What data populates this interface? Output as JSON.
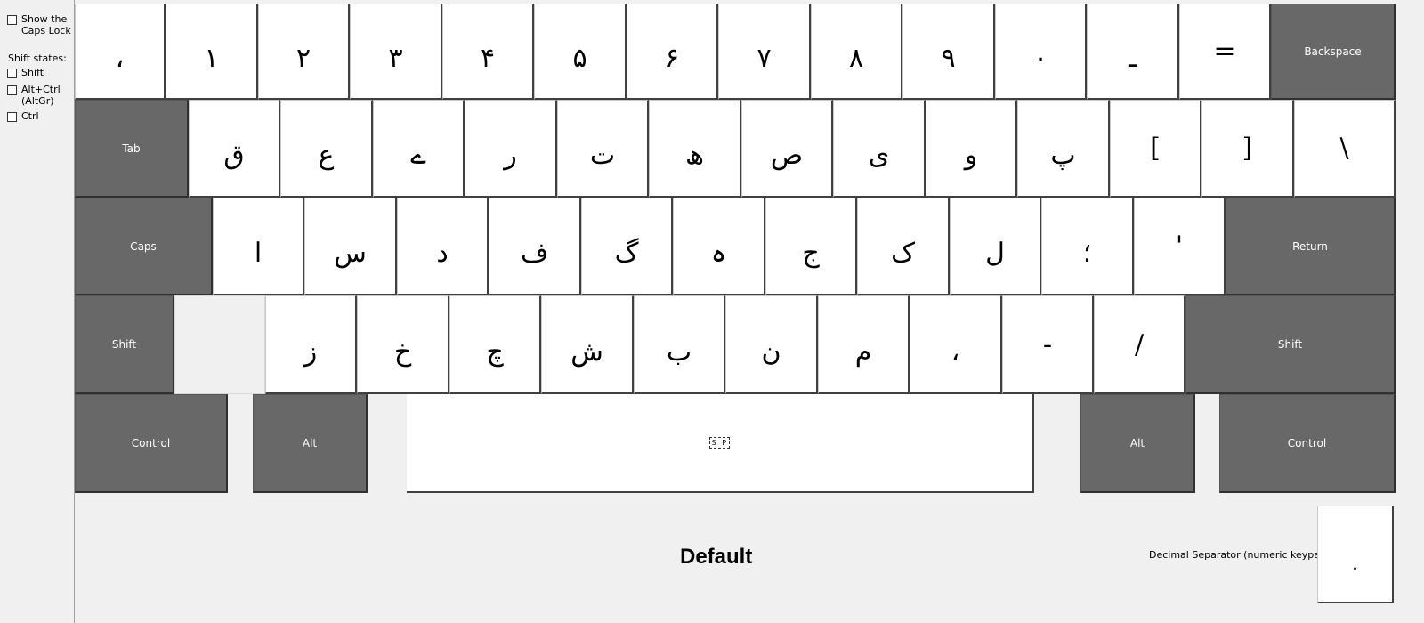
{
  "sidebar": {
    "show_caps_lock": "Show the Caps Lock",
    "shift_states_label": "Shift states:",
    "shift": "Shift",
    "altgr": "Alt+Ctrl (AltGr)",
    "ctrl": "Ctrl"
  },
  "keyboard": {
    "row1": [
      "،",
      "۱",
      "۲",
      "۳",
      "۴",
      "۵",
      "۶",
      "۷",
      "۸",
      "۹",
      "۰",
      "ـ",
      "="
    ],
    "backspace": "Backspace",
    "tab": "Tab",
    "row2": [
      "ق",
      "ع",
      "ے",
      "ر",
      "ت",
      "ھ",
      "ص",
      "ی",
      "و",
      "پ",
      "[",
      "]",
      "\\"
    ],
    "caps": "Caps",
    "row3": [
      "ا",
      "س",
      "د",
      "ف",
      "گ",
      "ہ",
      "ج",
      "ک",
      "ل",
      "؛",
      "'"
    ],
    "return": "Return",
    "shift_left": "Shift",
    "row4": [
      "ز",
      "خ",
      "چ",
      "ش",
      "ب",
      "ن",
      "م",
      "،",
      "-",
      "/"
    ],
    "shift_right": "Shift",
    "control_left": "Control",
    "alt_left": "Alt",
    "space": "S P",
    "alt_right": "Alt",
    "control_right": "Control"
  },
  "footer": {
    "state_label": "Default",
    "decimal_label": "Decimal Separator (numeric keypad)",
    "decimal_value": "."
  }
}
